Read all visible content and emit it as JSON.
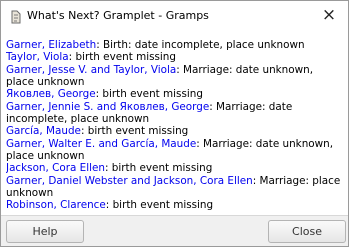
{
  "window": {
    "title": "What's Next? Gramplet - Gramps",
    "close_glyph": "×"
  },
  "entries": [
    {
      "people": [
        "Garner, Elizabeth"
      ],
      "text": ": Birth: date incomplete, place unknown"
    },
    {
      "people": [
        "Taylor, Viola"
      ],
      "text": ": birth event missing"
    },
    {
      "people": [
        "Garner, Jesse V. and Taylor, Viola"
      ],
      "text": ": Marriage: date unknown, place unknown"
    },
    {
      "people": [
        "Яковлев, George"
      ],
      "text": ": birth event missing"
    },
    {
      "people": [
        "Garner, Jennie S. and Яковлев, George"
      ],
      "text": ": Marriage: date incomplete, place unknown"
    },
    {
      "people": [
        "García, Maude"
      ],
      "text": ": birth event missing"
    },
    {
      "people": [
        "Garner, Walter E. and García, Maude"
      ],
      "text": ": Marriage: date unknown, place unknown"
    },
    {
      "people": [
        "Jackson, Cora Ellen"
      ],
      "text": ": birth event missing"
    },
    {
      "people": [
        "Garner, Daniel Webster and Jackson, Cora Ellen"
      ],
      "text": ": Marriage: place unknown"
    },
    {
      "people": [
        "Robinson, Clarence"
      ],
      "text": ": birth event missing"
    }
  ],
  "buttons": {
    "help": "Help",
    "close": "Close"
  },
  "colors": {
    "link": "#0000ee",
    "footer_bg": "#f0f0f0"
  }
}
